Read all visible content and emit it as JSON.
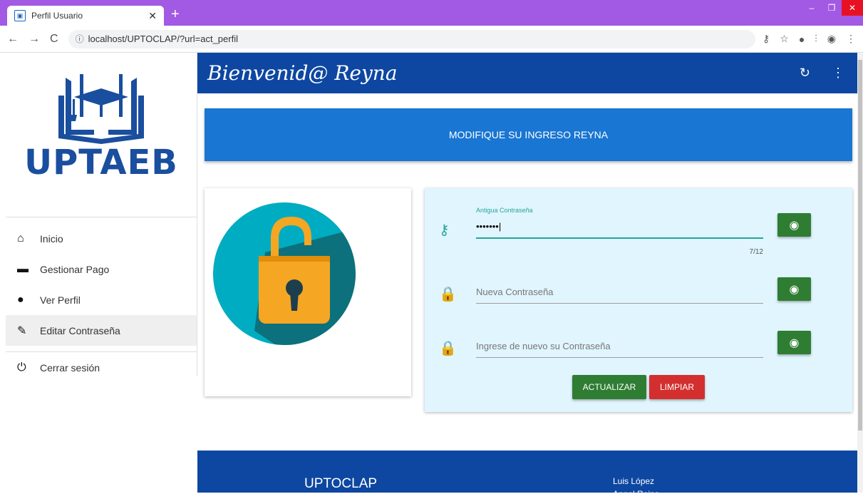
{
  "browser": {
    "tab_title": "Perfil Usuario",
    "url": "localhost/UPTOCLAP/?url=act_perfil"
  },
  "sidebar": {
    "logo_text": "UPTAEB",
    "items": [
      {
        "label": "Inicio",
        "icon": "home-icon"
      },
      {
        "label": "Gestionar Pago",
        "icon": "briefcase-icon"
      },
      {
        "label": "Ver Perfil",
        "icon": "person-icon"
      },
      {
        "label": "Editar Contraseña",
        "icon": "pencil-icon"
      }
    ],
    "logout": {
      "label": "Cerrar sesión",
      "icon": "power-icon"
    }
  },
  "header": {
    "welcome": "Bienvenid@ Reyna"
  },
  "banner": {
    "text": "MODIFIQUE SU INGRESO REYNA"
  },
  "form": {
    "old_password": {
      "label": "Antigua Contraseña",
      "value": "•••••••",
      "counter": "7/12"
    },
    "new_password": {
      "placeholder": "Nueva Contraseña"
    },
    "confirm_password": {
      "placeholder": "Ingrese de nuevo su Contraseña"
    },
    "update_label": "ACTUALIZAR",
    "clear_label": "LIMPIAR"
  },
  "footer": {
    "title": "UPTOCLAP",
    "name": "Luis López",
    "name2": "Angel Reina"
  },
  "colors": {
    "primary": "#0d47a1",
    "banner": "#1976d2",
    "success": "#2e7d32",
    "danger": "#d32f2f",
    "accent": "#26a69a"
  }
}
